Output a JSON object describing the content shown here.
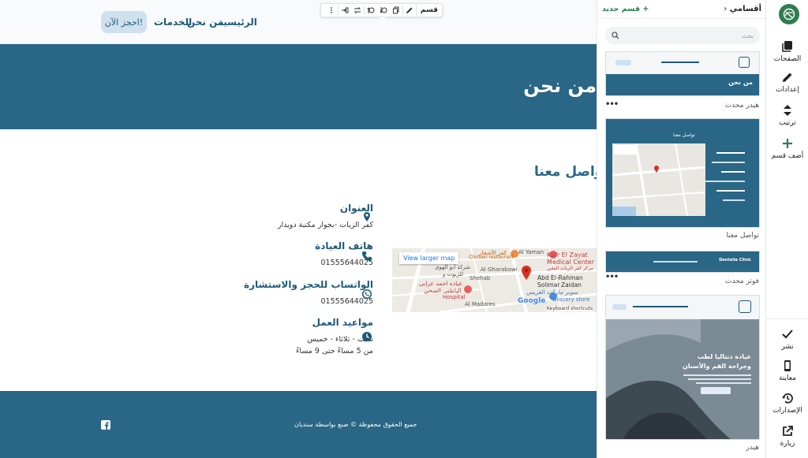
{
  "site": {
    "nav": {
      "home": "الرئيسية",
      "about": "من نحن",
      "services": "الخدمات"
    },
    "cta": "احجز الآن!",
    "banner_title": "من نحن",
    "section_title": "تواصل معنا",
    "contact": [
      {
        "heading": "العنوان",
        "value": "كفر الزيات -بجوار مكتبة دويدار",
        "icon": "location-pin-icon"
      },
      {
        "heading": "هاتف العيادة",
        "value": "01555644025",
        "icon": "phone-icon"
      },
      {
        "heading": "الواتساب للحجز والاستشارة",
        "value": "01555644025",
        "icon": "whatsapp-icon"
      },
      {
        "heading": "مواعيد العمل",
        "value": "سبت - ثلاثاء - خميس",
        "value2": "من 5 مساءً حتى 9 مساءً",
        "icon": "clock-icon"
      }
    ],
    "map": {
      "button": "View larger map",
      "labels": [
        "Al Yaman",
        "كفر الأشجار",
        "Chicken restaurant",
        "Kafr El Zayat",
        "Medical Center",
        "مركز كفر الزيات الطبي",
        "شركة أبو الهوى",
        "للزيوت و",
        "Al Gharabawi",
        "Shehab",
        "Abd El-Rahman Solimar",
        "Zaidan",
        "عياده احمد عرابى",
        "الباطنى الصحي",
        "Hospital",
        "سوبر ماركت الغريس",
        "Grocery store",
        "Al Madares",
        "Keyboard shortcuts",
        "Google"
      ]
    },
    "footer_text": "جميع الحقوق محفوظة © صنع بواسطة سنديان",
    "toolbar_label": "قسم"
  },
  "panel": {
    "title": "أقسامي",
    "new_section": "قسم جديد",
    "search_placeholder": "بحث",
    "sections": [
      {
        "label": "هيدر محدث",
        "thumb_title": "من نحن"
      },
      {
        "label": "تواصل معنا",
        "thumb_title": "تواصل معنا"
      },
      {
        "label": "فوتر محدث",
        "thumb_title": "Dentalia Clinic"
      },
      {
        "label": "هيدر",
        "thumb_title": "عيادة دنتاليا لطب وجراحة الفم والأسنان"
      }
    ],
    "more": "•••"
  },
  "rail": {
    "pages": "الصفحات",
    "settings": "إعدادات",
    "order": "ترتيب",
    "add_section": "أضف قسم",
    "publish": "نشر",
    "preview": "معاينة",
    "versions": "الإصدارات",
    "visit": "زيارة"
  },
  "colors": {
    "primary": "#2a6685",
    "accent": "#2e7d4f",
    "cta_bg": "#cfe0ef"
  }
}
